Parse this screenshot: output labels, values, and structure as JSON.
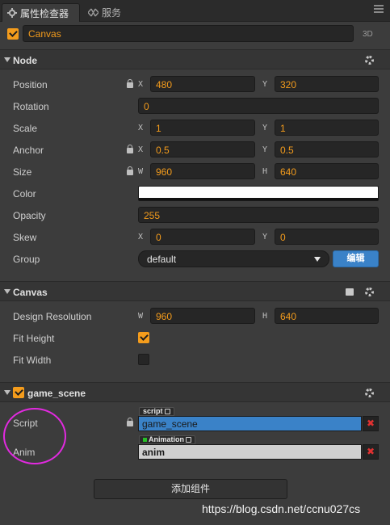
{
  "tabs": [
    {
      "label": "属性检查器",
      "icon": "gear-icon",
      "active": true
    },
    {
      "label": "服务",
      "icon": "services-icon",
      "active": false
    }
  ],
  "node": {
    "enabled": true,
    "name": "Canvas",
    "badge": "3D"
  },
  "node_section": {
    "title": "Node",
    "position": {
      "label": "Position",
      "x_axis": "X",
      "x": "480",
      "y_axis": "Y",
      "y": "320"
    },
    "rotation": {
      "label": "Rotation",
      "value": "0"
    },
    "scale": {
      "label": "Scale",
      "x_axis": "X",
      "x": "1",
      "y_axis": "Y",
      "y": "1"
    },
    "anchor": {
      "label": "Anchor",
      "x_axis": "X",
      "x": "0.5",
      "y_axis": "Y",
      "y": "0.5"
    },
    "size": {
      "label": "Size",
      "w_axis": "W",
      "w": "960",
      "h_axis": "H",
      "h": "640"
    },
    "color": {
      "label": "Color",
      "value": "#ffffff"
    },
    "opacity": {
      "label": "Opacity",
      "value": "255"
    },
    "skew": {
      "label": "Skew",
      "x_axis": "X",
      "x": "0",
      "y_axis": "Y",
      "y": "0"
    },
    "group": {
      "label": "Group",
      "value": "default",
      "edit_label": "编辑"
    }
  },
  "canvas_section": {
    "title": "Canvas",
    "design_resolution": {
      "label": "Design Resolution",
      "w_axis": "W",
      "w": "960",
      "h_axis": "H",
      "h": "640"
    },
    "fit_height": {
      "label": "Fit Height",
      "checked": true
    },
    "fit_width": {
      "label": "Fit Width",
      "checked": false
    }
  },
  "game_scene_section": {
    "title": "game_scene",
    "enabled": true,
    "script": {
      "label": "Script",
      "tag": "script",
      "value": "game_scene"
    },
    "anim": {
      "label": "Anim",
      "tag": "Animation",
      "value": "anim"
    },
    "remove_glyph": "✖"
  },
  "add_component_label": "添加组件",
  "watermark": "https://blog.csdn.net/ccnu027cs",
  "colors": {
    "accent": "#f49c1c",
    "primary_button": "#3a82c8",
    "annotation": "#e22ae0",
    "remove": "#e03131"
  }
}
